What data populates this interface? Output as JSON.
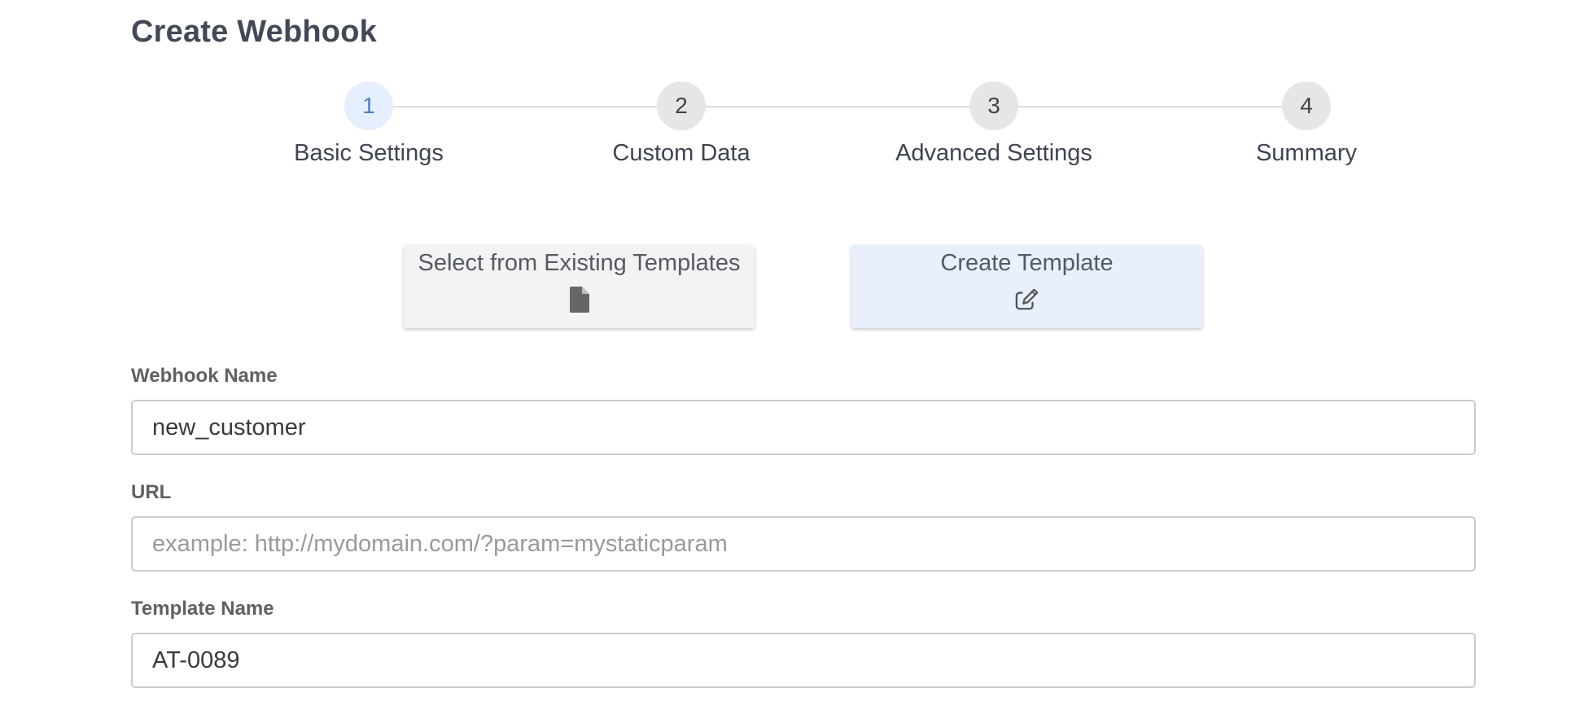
{
  "page": {
    "title": "Create Webhook"
  },
  "stepper": {
    "active_step": 1,
    "steps": [
      {
        "number": "1",
        "label": "Basic Settings"
      },
      {
        "number": "2",
        "label": "Custom Data"
      },
      {
        "number": "3",
        "label": "Advanced Settings"
      },
      {
        "number": "4",
        "label": "Summary"
      }
    ]
  },
  "template_options": {
    "existing": {
      "label": "Select from Existing Templates",
      "icon": "file-icon"
    },
    "create": {
      "label": "Create Template",
      "icon": "edit-icon",
      "selected": true
    }
  },
  "form": {
    "webhook_name": {
      "label": "Webhook Name",
      "value": "new_customer",
      "placeholder": ""
    },
    "url": {
      "label": "URL",
      "value": "",
      "placeholder": "example: http://mydomain.com/?param=mystaticparam"
    },
    "template_name": {
      "label": "Template Name",
      "value": "AT-0089",
      "placeholder": ""
    }
  },
  "colors": {
    "active_step_bg": "#e6effd",
    "active_step_text": "#4b7ec4",
    "inactive_step_bg": "#e6e6e6",
    "selected_card_bg": "#e8f0fd",
    "card_bg": "#f3f3f3"
  }
}
